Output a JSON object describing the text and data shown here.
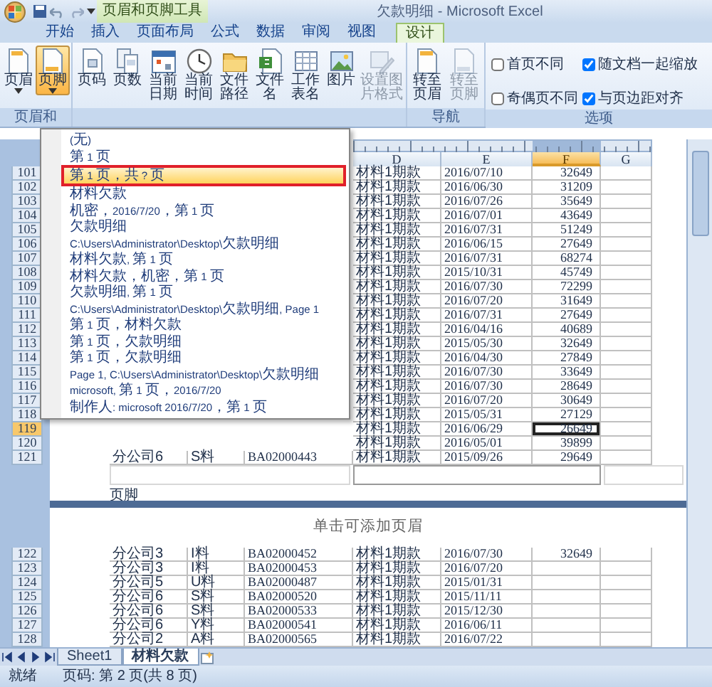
{
  "title_bar": {
    "context_label": "页眉和页脚工具",
    "title": "欠款明细 - Microsoft Excel"
  },
  "tabs": [
    {
      "label": "开始",
      "selected": false
    },
    {
      "label": "插入",
      "selected": false
    },
    {
      "label": "页面布局",
      "selected": false
    },
    {
      "label": "公式",
      "selected": false
    },
    {
      "label": "数据",
      "selected": false
    },
    {
      "label": "审阅",
      "selected": false
    },
    {
      "label": "视图",
      "selected": false
    },
    {
      "label": "设计",
      "selected": true
    }
  ],
  "ribbon": {
    "groups": [
      {
        "kind": "buttons",
        "label": "页眉和",
        "buttons": [
          {
            "label": "页眉",
            "active": false,
            "disabled": false,
            "dropdown": true
          },
          {
            "label": "页脚",
            "active": true,
            "disabled": false,
            "dropdown": true
          }
        ]
      },
      {
        "kind": "buttons",
        "buttons": [
          {
            "label": "页码",
            "active": false,
            "disabled": false
          },
          {
            "label": "页数",
            "active": false,
            "disabled": false
          },
          {
            "label": "当前日期",
            "active": false,
            "disabled": false
          },
          {
            "label": "当前时间",
            "active": false,
            "disabled": false
          },
          {
            "label": "文件路径",
            "active": false,
            "disabled": false
          },
          {
            "label": "文件名",
            "active": false,
            "disabled": false
          },
          {
            "label": "工作表名",
            "active": false,
            "disabled": false
          },
          {
            "label": "图片",
            "active": false,
            "disabled": false
          },
          {
            "label": "设置图片格式",
            "active": false,
            "disabled": true
          }
        ]
      },
      {
        "kind": "buttons",
        "label": "导航",
        "buttons": [
          {
            "label": "转至页眉",
            "active": false,
            "disabled": false
          },
          {
            "label": "转至页脚",
            "active": false,
            "disabled": true
          }
        ]
      },
      {
        "kind": "options",
        "label": "选项",
        "options": [
          {
            "label": "首页不同",
            "checked": false
          },
          {
            "label": "随文档一起缩放",
            "checked": true
          },
          {
            "label": "奇偶页不同",
            "checked": false
          },
          {
            "label": "与页边距对齐",
            "checked": true
          }
        ]
      }
    ]
  },
  "footer_menu": {
    "items": [
      {
        "label": "(无)",
        "selected": false
      },
      {
        "label": "第 1 页",
        "selected": false
      },
      {
        "label": "第 1 页，共 ? 页",
        "selected": true
      },
      {
        "label": "材料欠款",
        "selected": false
      },
      {
        "label": " 机密，2016/7/20，第 1 页",
        "selected": false
      },
      {
        "label": "欠款明细",
        "selected": false
      },
      {
        "label": "C:\\Users\\Administrator\\Desktop\\欠款明细",
        "selected": false
      },
      {
        "label": "材料欠款, 第 1 页",
        "selected": false
      },
      {
        "label": "材料欠款，机密，第 1 页",
        "selected": false
      },
      {
        "label": "欠款明细, 第 1 页",
        "selected": false
      },
      {
        "label": "C:\\Users\\Administrator\\Desktop\\欠款明细, Page 1",
        "selected": false
      },
      {
        "label": "第 1 页，材料欠款",
        "selected": false
      },
      {
        "label": "第 1 页，欠款明细",
        "selected": false
      },
      {
        "label": "第 1 页，欠款明细",
        "selected": false
      },
      {
        "label": "Page 1, C:\\Users\\Administrator\\Desktop\\欠款明细",
        "selected": false
      },
      {
        "label": "microsoft, 第 1 页，2016/7/20",
        "selected": false
      },
      {
        "label": "制作人: microsoft 2016/7/20，第 1 页",
        "selected": false
      }
    ]
  },
  "sheet": {
    "columns": [
      null,
      null,
      null,
      {
        "label": "D",
        "selected": false
      },
      {
        "label": "E",
        "selected": false
      },
      {
        "label": "F",
        "selected": true
      },
      {
        "label": "G",
        "selected": false
      }
    ],
    "rows": [
      {
        "number": "101",
        "selected": false,
        "cells": [
          null,
          null,
          null,
          "材料1期款",
          "2016/07/10",
          "32649"
        ]
      },
      {
        "number": "102",
        "selected": false,
        "cells": [
          null,
          null,
          null,
          "材料1期款",
          "2016/06/30",
          "31209"
        ]
      },
      {
        "number": "103",
        "selected": false,
        "cells": [
          null,
          null,
          null,
          "材料1期款",
          "2016/07/26",
          "35649"
        ]
      },
      {
        "number": "104",
        "selected": false,
        "cells": [
          null,
          null,
          null,
          "材料1期款",
          "2016/07/01",
          "43649"
        ]
      },
      {
        "number": "105",
        "selected": false,
        "cells": [
          null,
          null,
          null,
          "材料1期款",
          "2016/07/31",
          "51249"
        ]
      },
      {
        "number": "106",
        "selected": false,
        "cells": [
          null,
          null,
          null,
          "材料1期款",
          "2016/06/15",
          "27649"
        ]
      },
      {
        "number": "107",
        "selected": false,
        "cells": [
          null,
          null,
          null,
          "材料1期款",
          "2016/07/31",
          "68274"
        ]
      },
      {
        "number": "108",
        "selected": false,
        "cells": [
          null,
          null,
          null,
          "材料1期款",
          "2015/10/31",
          "45749"
        ]
      },
      {
        "number": "109",
        "selected": false,
        "cells": [
          null,
          null,
          null,
          "材料1期款",
          "2016/07/30",
          "72299"
        ]
      },
      {
        "number": "110",
        "selected": false,
        "cells": [
          null,
          null,
          null,
          "材料1期款",
          "2016/07/20",
          "31649"
        ]
      },
      {
        "number": "111",
        "selected": false,
        "cells": [
          null,
          null,
          null,
          "材料1期款",
          "2016/07/31",
          "27649"
        ]
      },
      {
        "number": "112",
        "selected": false,
        "cells": [
          null,
          null,
          null,
          "材料1期款",
          "2016/04/16",
          "40689"
        ]
      },
      {
        "number": "113",
        "selected": false,
        "cells": [
          null,
          null,
          null,
          "材料1期款",
          "2015/05/30",
          "32649"
        ]
      },
      {
        "number": "114",
        "selected": false,
        "cells": [
          null,
          null,
          null,
          "材料1期款",
          "2016/04/30",
          "27849"
        ]
      },
      {
        "number": "115",
        "selected": false,
        "cells": [
          null,
          null,
          null,
          "材料1期款",
          "2016/07/30",
          "33649"
        ]
      },
      {
        "number": "116",
        "selected": false,
        "cells": [
          null,
          null,
          null,
          "材料1期款",
          "2016/07/30",
          "28649"
        ]
      },
      {
        "number": "117",
        "selected": false,
        "cells": [
          null,
          null,
          null,
          "材料1期款",
          "2016/07/20",
          "30649"
        ]
      },
      {
        "number": "118",
        "selected": false,
        "cells": [
          null,
          null,
          null,
          "材料1期款",
          "2015/05/31",
          "27129"
        ]
      },
      {
        "number": "119",
        "selected": true,
        "cells": [
          null,
          null,
          null,
          "材料1期款",
          "2016/06/29",
          "26649"
        ]
      },
      {
        "number": "120",
        "selected": false,
        "cells": [
          null,
          null,
          null,
          "材料1期款",
          "2016/05/01",
          "39899"
        ]
      },
      {
        "number": "121",
        "selected": false,
        "cells": [
          "分公司6",
          "S料",
          "BA02000443",
          "材料1期款",
          "2015/09/26",
          "29649"
        ]
      }
    ],
    "footer_label": "页脚",
    "page2_header": "单击可添加页眉",
    "page2_rows": [
      {
        "number": "122",
        "selected": false,
        "cells": [
          "分公司3",
          "I料",
          "BA02000452",
          "材料1期款",
          "2016/07/30",
          "32649"
        ]
      },
      {
        "number": "123",
        "selected": false,
        "cells": [
          "分公司3",
          "I料",
          "BA02000453",
          "材料1期款",
          "2016/07/20",
          null
        ]
      },
      {
        "number": "124",
        "selected": false,
        "cells": [
          "分公司5",
          "U料",
          "BA02000487",
          "材料1期款",
          "2015/01/31",
          null
        ]
      },
      {
        "number": "125",
        "selected": false,
        "cells": [
          "分公司6",
          "S料",
          "BA02000520",
          "材料1期款",
          "2015/11/11",
          null
        ]
      },
      {
        "number": "126",
        "selected": false,
        "cells": [
          "分公司6",
          "S料",
          "BA02000533",
          "材料1期款",
          "2015/12/30",
          null
        ]
      },
      {
        "number": "127",
        "selected": false,
        "cells": [
          "分公司6",
          "Y料",
          "BA02000541",
          "材料1期款",
          "2016/06/11",
          null
        ]
      },
      {
        "number": "128",
        "selected": false,
        "cells": [
          "分公司2",
          "A料",
          "BA02000565",
          "材料1期款",
          "2016/07/22",
          null
        ]
      }
    ]
  },
  "sheet_tabs": [
    {
      "label": "Sheet1",
      "selected": false
    },
    {
      "label": "材料欠款",
      "selected": true
    }
  ],
  "status_bar": {
    "mode": "就绪",
    "page": "页码: 第 2 页(共 8 页)"
  }
}
